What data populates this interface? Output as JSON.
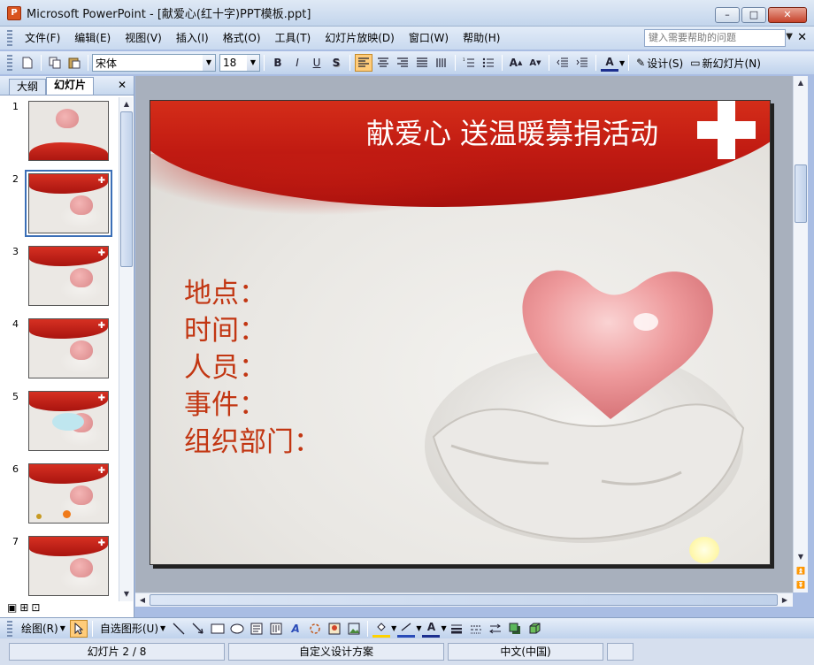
{
  "window": {
    "title": "Microsoft PowerPoint - [献爱心(红十字)PPT模板.ppt]",
    "controls": {
      "minimize": "–",
      "restore": "□",
      "close": "✕"
    }
  },
  "menubar": {
    "items": [
      "文件(F)",
      "编辑(E)",
      "视图(V)",
      "插入(I)",
      "格式(O)",
      "工具(T)",
      "幻灯片放映(D)",
      "窗口(W)",
      "帮助(H)"
    ],
    "help_placeholder": "键入需要帮助的问题"
  },
  "toolbar": {
    "font_name": "宋体",
    "font_size": "18",
    "bold": "B",
    "italic": "I",
    "underline": "U",
    "shadow": "S",
    "design_label": "设计(S)",
    "new_slide_label": "新幻灯片(N)"
  },
  "left_pane": {
    "tabs": [
      "大纲",
      "幻灯片"
    ],
    "active_tab": "幻灯片",
    "slides": [
      {
        "number": "1"
      },
      {
        "number": "2"
      },
      {
        "number": "3"
      },
      {
        "number": "4"
      },
      {
        "number": "5"
      },
      {
        "number": "6"
      },
      {
        "number": "7"
      }
    ],
    "selected_slide": "2"
  },
  "slide": {
    "title": "献爱心 送温暖募捐活动",
    "fields": [
      "地点：",
      "时间：",
      "人员：",
      "事件：",
      "组织部门："
    ]
  },
  "drawbar": {
    "draw_label": "绘图(R)",
    "autoshapes_label": "自选图形(U)"
  },
  "status": {
    "slide_indicator": "幻灯片 2 / 8",
    "design": "自定义设计方案",
    "language": "中文(中国)"
  },
  "colors": {
    "accent_red": "#c11b12",
    "field_text": "#c23612",
    "selection_blue": "#3b6fb7"
  }
}
